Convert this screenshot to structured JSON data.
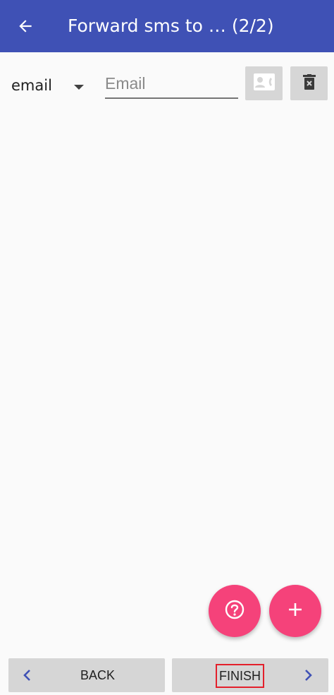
{
  "toolbar": {
    "title": "Forward sms to … (2/2)",
    "back_icon": "arrow-back-icon"
  },
  "row": {
    "type_value": "email",
    "email_placeholder": "Email",
    "email_value": "",
    "contact_icon": "contact-card-icon",
    "delete_icon": "delete-icon"
  },
  "fabs": {
    "help_icon": "help-icon",
    "add_icon": "add-icon"
  },
  "nav": {
    "back_label": "BACK",
    "finish_label": "FINISH"
  },
  "colors": {
    "toolbar": "#3f51b5",
    "fab": "#f5427a",
    "nav_chevron": "#3f51b5",
    "highlight": "#e3202b"
  }
}
